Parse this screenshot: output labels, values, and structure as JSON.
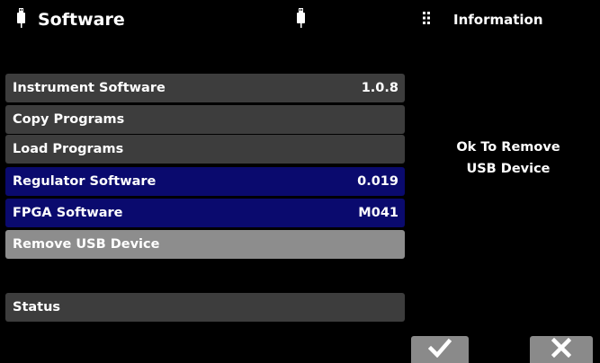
{
  "header": {
    "title": "Software",
    "info_title": "Information"
  },
  "icons": {
    "usb_left": "usb-icon",
    "usb_center": "usb-icon",
    "menu": "grid-icon",
    "accept": "checkmark-icon",
    "cancel": "close-icon"
  },
  "colors": {
    "row_gray": "#3d3d3d",
    "row_blue": "#0a0a6e",
    "row_selected": "#8d8d8d",
    "button": "#8a8a8a"
  },
  "rows": [
    {
      "label": "Instrument Software",
      "value": "1.0.8"
    },
    {
      "label": "Copy Programs",
      "value": ""
    },
    {
      "label": "Load Programs",
      "value": ""
    },
    {
      "label": "Regulator Software",
      "value": "0.019"
    },
    {
      "label": "FPGA Software",
      "value": "M041"
    },
    {
      "label": "Remove USB Device",
      "value": ""
    },
    {
      "label": "Status",
      "value": ""
    }
  ],
  "info_message": {
    "line1": "Ok To Remove",
    "line2": "USB Device"
  }
}
